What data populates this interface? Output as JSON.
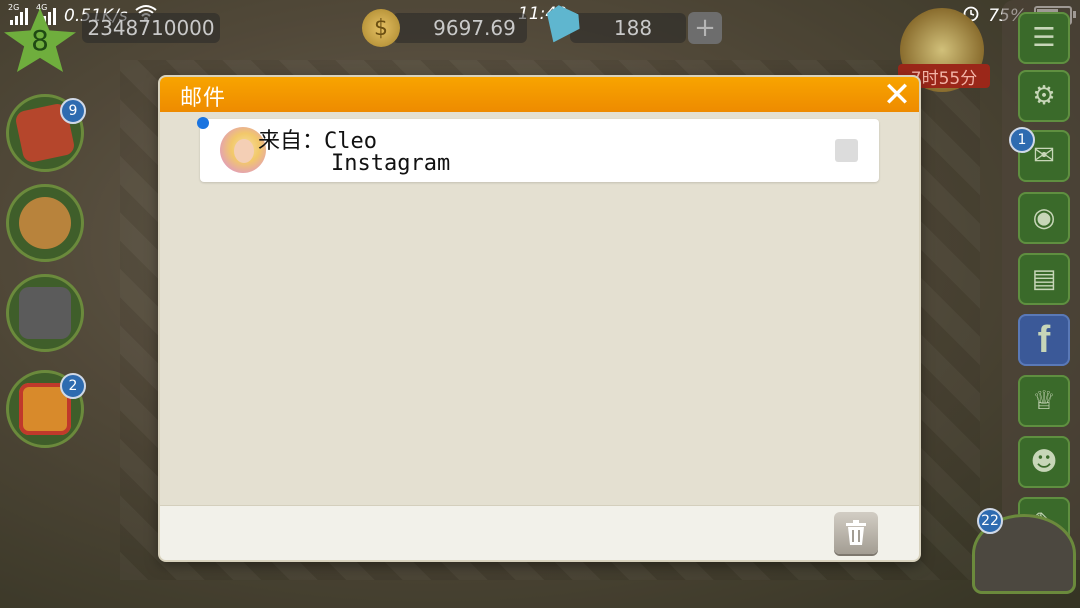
{
  "status_bar": {
    "net1": "2G",
    "net2": "4G",
    "speed": "0.51K/s",
    "time": "11:40",
    "battery": "75%",
    "battery_level": 0.75,
    "icons": [
      "signal-icon",
      "wifi-icon",
      "alarm-icon",
      "battery-icon"
    ]
  },
  "hud": {
    "level": "8",
    "experience": "2348710000",
    "coins": "9697.69",
    "gems": "188",
    "plus": "+",
    "timer": "7时55分"
  },
  "left_buttons": [
    {
      "name": "recipe-book",
      "badge": "9"
    },
    {
      "name": "stove",
      "badge": ""
    },
    {
      "name": "phone",
      "badge": ""
    },
    {
      "name": "gift",
      "badge": "2"
    }
  ],
  "right_rail": [
    {
      "name": "menu-icon",
      "badge": ""
    },
    {
      "name": "gear-icon",
      "badge": ""
    },
    {
      "name": "mail-icon",
      "badge": "1"
    },
    {
      "name": "food-icon",
      "badge": ""
    },
    {
      "name": "notepad-icon",
      "badge": ""
    },
    {
      "name": "facebook-icon",
      "badge": "",
      "label": "f"
    },
    {
      "name": "trophy-icon",
      "badge": ""
    },
    {
      "name": "waiter-icon",
      "badge": ""
    },
    {
      "name": "chat-icon",
      "badge": ""
    }
  ],
  "pot_badge": "22",
  "dialog": {
    "title": "邮件",
    "close_label": "✕",
    "mail_items": [
      {
        "from": "来自：Cleo",
        "subject": "Instagram",
        "unread": true,
        "checked": false
      }
    ],
    "delete_icon": "trash-icon"
  },
  "colors": {
    "header": "#f29a00",
    "unread_dot": "#1a74e0",
    "facebook": "#3b5998"
  }
}
